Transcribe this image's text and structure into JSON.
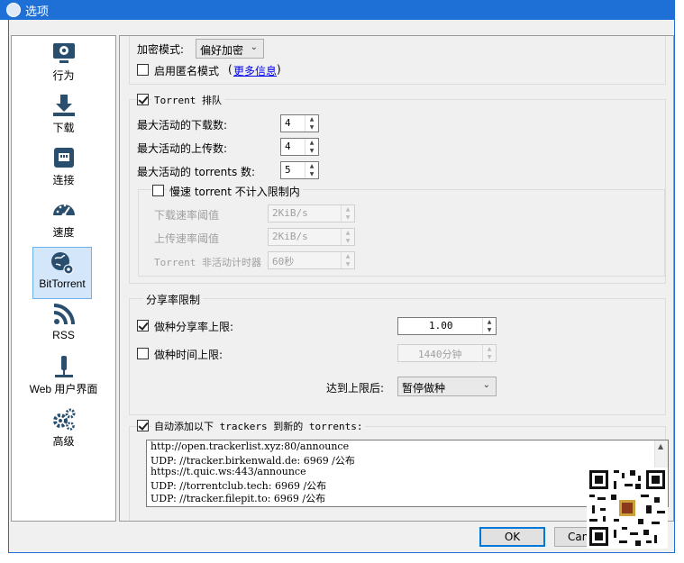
{
  "window": {
    "title": "选项"
  },
  "sidebar": {
    "items": [
      {
        "label": "行为",
        "icon": "behavior-icon"
      },
      {
        "label": "下载",
        "icon": "download-icon"
      },
      {
        "label": "连接",
        "icon": "connection-icon"
      },
      {
        "label": "速度",
        "icon": "speed-icon"
      },
      {
        "label": "BitTorrent",
        "icon": "bittorrent-icon",
        "active": true
      },
      {
        "label": "RSS",
        "icon": "rss-icon"
      },
      {
        "label": "Web 用户界面",
        "icon": "webui-icon"
      },
      {
        "label": "高级",
        "icon": "advanced-icon"
      }
    ]
  },
  "privacy": {
    "encryption_label": "加密模式:",
    "encryption_value": "偏好加密",
    "anonymous_label": "启用匿名模式",
    "more_info_open": "(",
    "more_info_link": "更多信息",
    "more_info_close": ")"
  },
  "queue": {
    "title": "Torrent 排队",
    "checked": true,
    "max_downloads_label": "最大活动的下载数:",
    "max_downloads": "4",
    "max_uploads_label": "最大活动的上传数:",
    "max_uploads": "4",
    "max_torrents_label": "最大活动的 torrents 数:",
    "max_torrents": "5",
    "slow": {
      "title": "慢速 torrent 不计入限制内",
      "checked": false,
      "dl_label": "下载速率阈值",
      "dl_value": "2KiB/s",
      "ul_label": "上传速率阈值",
      "ul_value": "2KiB/s",
      "timer_label": "Torrent 非活动计时器",
      "timer_value": "60秒"
    }
  },
  "ratio": {
    "title": "分享率限制",
    "seed_ratio_label": "做种分享率上限:",
    "seed_ratio_checked": true,
    "seed_ratio_value": "1.00",
    "seed_time_label": "做种时间上限:",
    "seed_time_checked": false,
    "seed_time_value": "1440分钟",
    "action_label": "达到上限后:",
    "action_value": "暂停做种"
  },
  "trackers": {
    "label": "自动添加以下 trackers 到新的 torrents:",
    "checked": true,
    "lines": [
      "http://open.trackerlist.xyz:80/announce",
      "UDP: //tracker.birkenwald.de: 6969 /公布",
      "https://t.quic.ws:443/announce",
      "UDP: //torrentclub.tech: 6969 /公布",
      "UDP: //tracker.filepit.to: 6969 /公布"
    ]
  },
  "buttons": {
    "ok": "OK",
    "cancel": "Can"
  }
}
